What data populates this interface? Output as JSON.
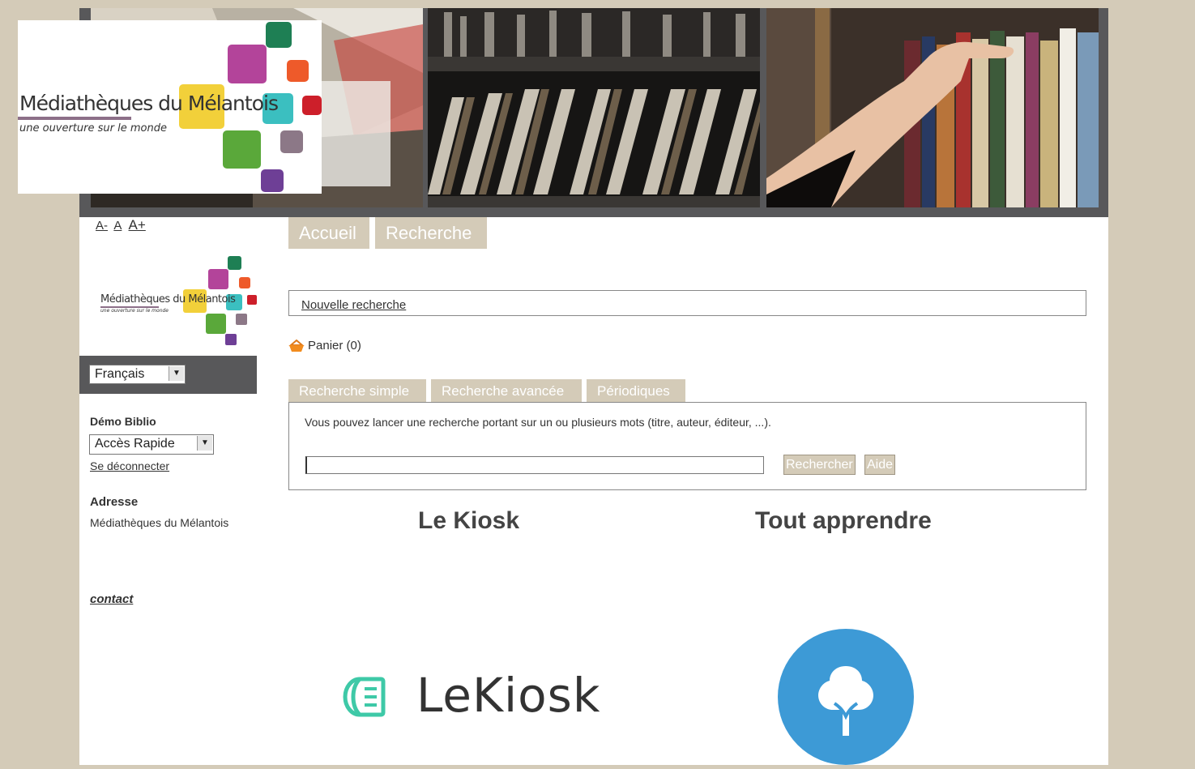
{
  "brand": {
    "logo_title": "Médiathèques du Mélantois",
    "logo_tagline": "une ouverture sur le monde",
    "colors": {
      "page_bg": "#d4cbb8",
      "dark_bar": "#58585a",
      "tab_bg": "#d4cbb8"
    }
  },
  "font_size_controls": [
    "A-",
    "A",
    "A+"
  ],
  "nav": {
    "tabs": [
      {
        "label": "Accueil"
      },
      {
        "label": "Recherche"
      }
    ]
  },
  "new_search_link": "Nouvelle recherche",
  "cart": {
    "label": "Panier (0)",
    "icon": "basket-icon"
  },
  "language": {
    "selected": "Français"
  },
  "user": {
    "name": "Démo Biblio",
    "quick_access": "Accès Rapide",
    "logout": "Se déconnecter"
  },
  "address": {
    "heading": "Adresse",
    "value": "Médiathèques du Mélantois"
  },
  "contact_link": "contact",
  "search": {
    "tabs": [
      {
        "label": "Recherche simple"
      },
      {
        "label": "Recherche avancée"
      },
      {
        "label": "Périodiques"
      }
    ],
    "hint": "Vous pouvez lancer une recherche portant sur un ou plusieurs mots (titre, auteur, éditeur, ...).",
    "input_value": "",
    "search_button": "Rechercher",
    "help_button": "Aide"
  },
  "sections": [
    {
      "title": "Le Kiosk",
      "logo_text": "LeKiosk",
      "logo_color": "#3ec9a7"
    },
    {
      "title": "Tout apprendre",
      "logo_icon": "tree-icon",
      "logo_color": "#3d9ad6"
    }
  ]
}
